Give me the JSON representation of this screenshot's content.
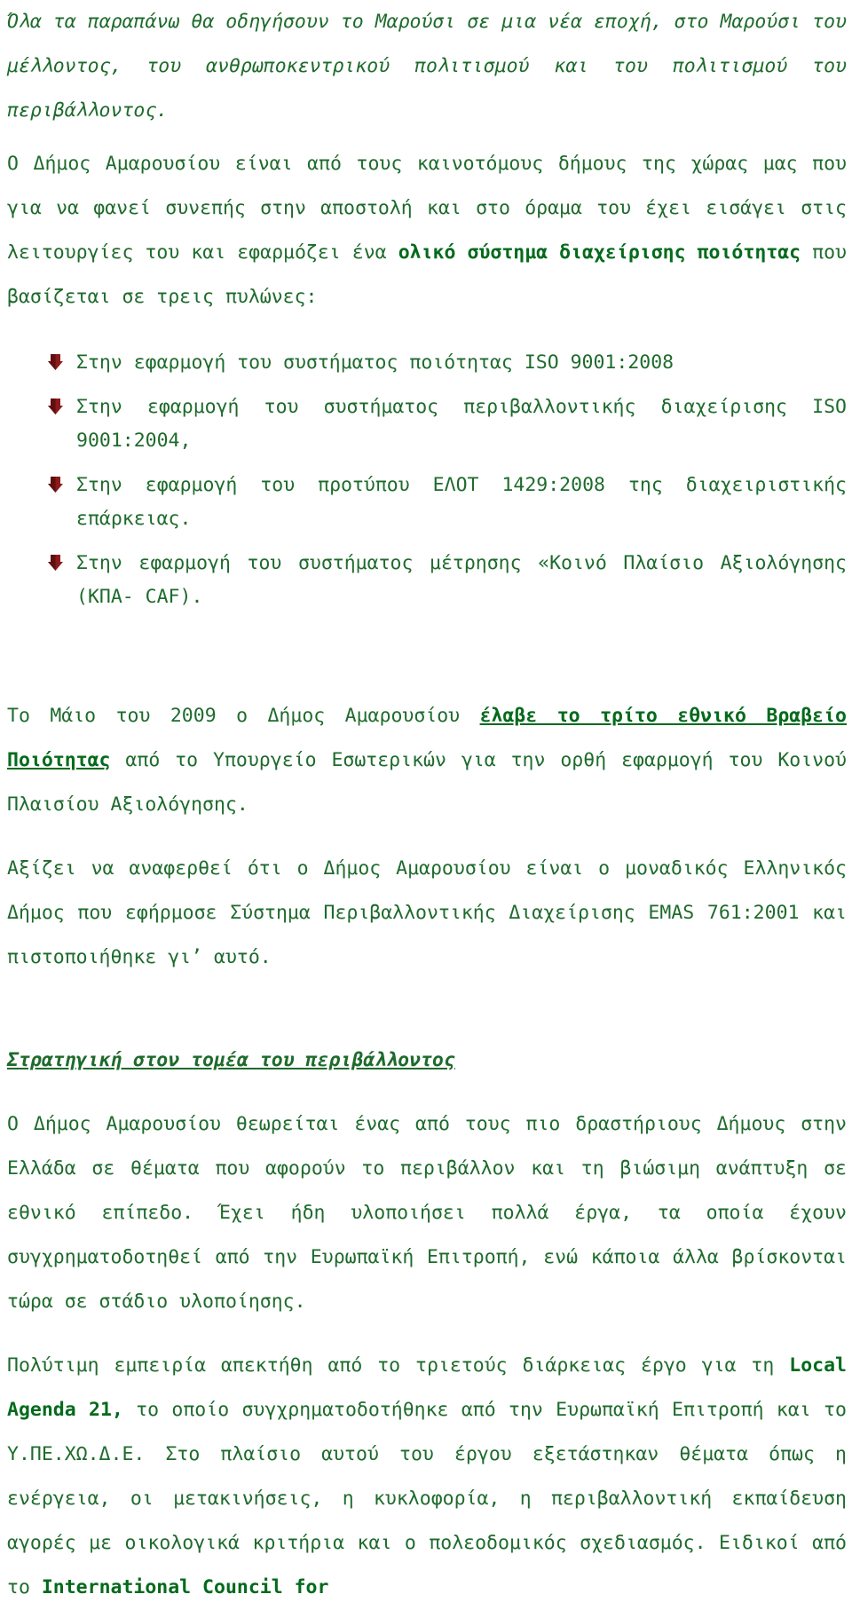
{
  "document": {
    "text_color": "#1e6b2c",
    "bold_color": "#046a1c",
    "bullet_color": "#8b1a1a",
    "background": "#ffffff",
    "paragraphs": {
      "intro_italic": "Όλα τα παραπάνω θα οδηγήσουν το Μαρούσι σε μια νέα εποχή, στο Μαρούσι του μέλλοντος, του ανθρωποκεντρικού πολιτισμού και του πολιτισμού του περιβάλλοντος.",
      "quality_system": {
        "part1": "Ο Δήμος Αμαρουσίου είναι από τους καινοτόμους δήμους της χώρας μας που για να φανεί συνεπής στην αποστολή και στο όραμα του έχει εισάγει στις λειτουργίες του και εφαρμόζει ένα ",
        "bold": "ολικό σύστημα διαχείρισης ποιότητας",
        "part2": " που βασίζεται σε τρεις πυλώνες:"
      },
      "award": {
        "part1": "Το Μάιο του 2009 ο Δήμος Αμαρουσίου ",
        "bold_underline": "έλαβε το τρίτο εθνικό Βραβείο Ποιότητας",
        "part2": " από το Υπουργείο Εσωτερικών για την ορθή εφαρμογή του Κοινού Πλαισίου Αξιολόγησης."
      },
      "emas": "Αξίζει να αναφερθεί ότι ο Δήμος Αμαρουσίου είναι ο μοναδικός Ελληνικός Δήμος που εφήρμοσε Σύστημα Περιβαλλοντικής Διαχείρισης EMAS 761:2001 και πιστοποιήθηκε γι’ αυτό.",
      "environment_intro": "Ο Δήμος Αμαρουσίου θεωρείται ένας από τους πιο δραστήριους Δήμους στην Ελλάδα σε θέματα που αφορούν το περιβάλλον και τη βιώσιμη ανάπτυξη σε εθνικό επίπεδο. Έχει ήδη υλοποιήσει πολλά έργα, τα οποία έχουν συγχρηματοδοτηθεί από την Ευρωπαϊκή Επιτροπή, ενώ κάποια άλλα βρίσκονται τώρα σε στάδιο υλοποίησης.",
      "local_agenda": {
        "part1": "Πολύτιμη εμπειρία απεκτήθη από το τριετούς διάρκειας έργο για τη ",
        "bold1": "Local Agenda 21,",
        "part2": " το οποίο συγχρηματοδοτήθηκε από την Ευρωπαϊκή Επιτροπή και το Υ.ΠΕ.ΧΩ.Δ.Ε. Στο πλαίσιο αυτού του έργου εξετάστηκαν θέματα όπως η ενέργεια, οι μετακινήσεις, η κυκλοφορία, η περιβαλλοντική εκπαίδευση αγορές με οικολογικά κριτήρια και ο πολεοδομικός σχεδιασμός. Ειδικοί από το ",
        "bold2": "International Council for"
      }
    },
    "heading_environment": "Στρατηγική στον τομέα του περιβάλλοντος",
    "bullets": [
      "Στην εφαρμογή του συστήματος ποιότητας ISO 9001:2008",
      "Στην εφαρμογή του συστήματος περιβαλλοντικής διαχείρισης ISO 9001:2004,",
      "Στην εφαρμογή του προτύπου ΕΛΟΤ 1429:2008 της διαχειριστικής επάρκειας.",
      "Στην εφαρμογή του συστήματος μέτρησης «Κοινό Πλαίσιο Αξιολόγησης (ΚΠΑ- CAF)."
    ]
  }
}
